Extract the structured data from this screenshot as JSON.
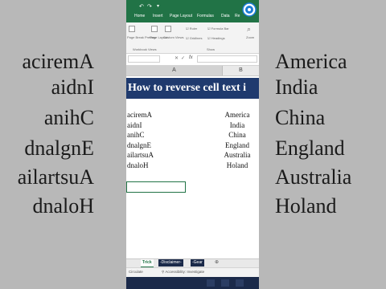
{
  "ribbon_tabs": [
    "Home",
    "Insert",
    "Page Layout",
    "Formulas",
    "Data",
    "Re"
  ],
  "ribbon": {
    "page_break": "Page Break Preview",
    "page_layout": "Page Layout",
    "custom_views": "Custom Views",
    "workbook_views": "Workbook Views",
    "ruler": "Ruler",
    "gridlines": "Gridlines",
    "formula_bar": "Formula Bar",
    "headings": "Headings",
    "show": "Show",
    "zoom": "Zoom"
  },
  "columns": {
    "a": "A",
    "b": "B"
  },
  "banner": "How to reverse cell text i",
  "rows": [
    {
      "reversed": "aciremA",
      "original": "America"
    },
    {
      "reversed": "aidnI",
      "original": "India"
    },
    {
      "reversed": "anihC",
      "original": "China"
    },
    {
      "reversed": "dnalgnE",
      "original": "England"
    },
    {
      "reversed": "ailartsuA",
      "original": "Australia"
    },
    {
      "reversed": "dnaloH",
      "original": "Holand"
    }
  ],
  "sheet_tabs": [
    "Trick",
    "-Disclaimer-",
    "-Gear"
  ],
  "status": {
    "left": "Circulate",
    "accessibility": "Accessibility: Investigate"
  },
  "colors": {
    "excel_green": "#217346",
    "banner_blue": "#1f3a6e"
  }
}
